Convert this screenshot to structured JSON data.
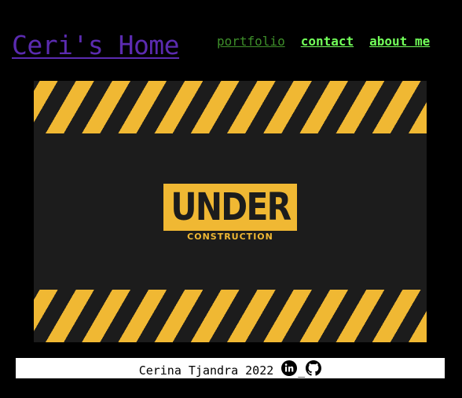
{
  "header": {
    "site_title": "Ceri's Home"
  },
  "nav": {
    "items": [
      {
        "label": "portfolio"
      },
      {
        "label": "contact"
      },
      {
        "label": "about me"
      }
    ]
  },
  "hero": {
    "sign_main": "UNDER",
    "sign_sub": "CONSTRUCTION"
  },
  "footer": {
    "text": "Cerina Tjandra 2022",
    "separator": "_",
    "icons": [
      "linkedin-icon",
      "github-icon"
    ]
  },
  "colors": {
    "background": "#000000",
    "title": "#5b2bb0",
    "nav_visited": "#3e8f2a",
    "nav_link": "#72ff5a",
    "hazard_yellow": "#f0b833",
    "hazard_dark": "#1c1c1c",
    "footer_bg": "#ffffff"
  }
}
